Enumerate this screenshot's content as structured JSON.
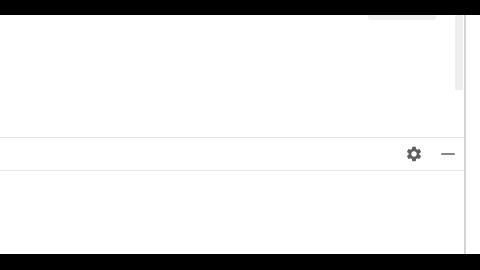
{
  "top_pane": {
    "content": ""
  },
  "panel": {
    "header": {
      "settings_icon": "gear-icon",
      "minimize_icon": "minimize-icon"
    },
    "body": {
      "content": ""
    }
  },
  "colors": {
    "letterbox": "#000000",
    "background": "#ffffff",
    "divider": "#e2e2e2",
    "icon": "#5f5f5f",
    "edge": "#d4d4d4"
  }
}
